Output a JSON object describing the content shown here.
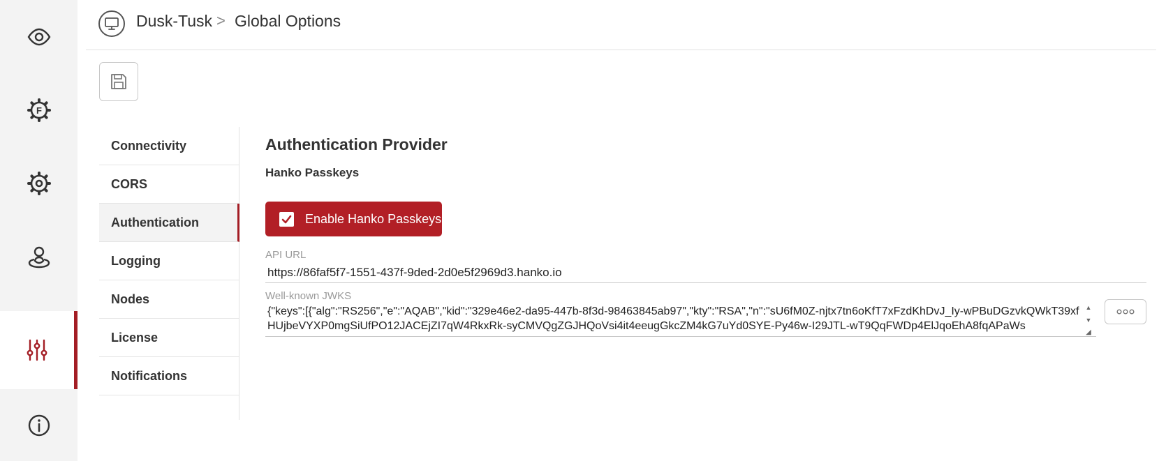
{
  "header": {
    "app_name": "Dusk-Tusk",
    "separator": ">",
    "page": "Global Options"
  },
  "rail": {
    "items": [
      {
        "icon": "eye-icon"
      },
      {
        "icon": "f-gear-icon"
      },
      {
        "icon": "gear-icon"
      },
      {
        "icon": "user-pin-icon"
      },
      {
        "icon": "sliders-icon",
        "active": true
      },
      {
        "icon": "info-icon"
      }
    ]
  },
  "nav": {
    "items": [
      {
        "label": "Connectivity"
      },
      {
        "label": "CORS"
      },
      {
        "label": "Authentication",
        "active": true
      },
      {
        "label": "Logging"
      },
      {
        "label": "Nodes"
      },
      {
        "label": "License"
      },
      {
        "label": "Notifications"
      }
    ]
  },
  "main": {
    "section_title": "Authentication Provider",
    "sub_title": "Hanko Passkeys",
    "toggle_label": "Enable Hanko Passkeys",
    "toggle_checked": true,
    "api_url_label": "API URL",
    "api_url_value": "https://86faf5f7-1551-437f-9ded-2d0e5f2969d3.hanko.io",
    "jwks_label": "Well-known JWKS",
    "jwks_value": "{\"keys\":[{\"alg\":\"RS256\",\"e\":\"AQAB\",\"kid\":\"329e46e2-da95-447b-8f3d-98463845ab97\",\"kty\":\"RSA\",\"n\":\"sU6fM0Z-njtx7tn6oKfT7xFzdKhDvJ_Iy-wPBuDGzvkQWkT39xfHUjbeVYXP0mgSiUfPO12JACEjZI7qW4RkxRk-syCMVQgZGJHQoVsi4it4eeugGkcZM4kG7uYd0SYE-Py46w-I29JTL-wT9QqFWDp4ElJqoEhA8fqAPaWs"
  },
  "colors": {
    "accent": "#b21f26",
    "rail_bg": "#f3f3f3"
  }
}
